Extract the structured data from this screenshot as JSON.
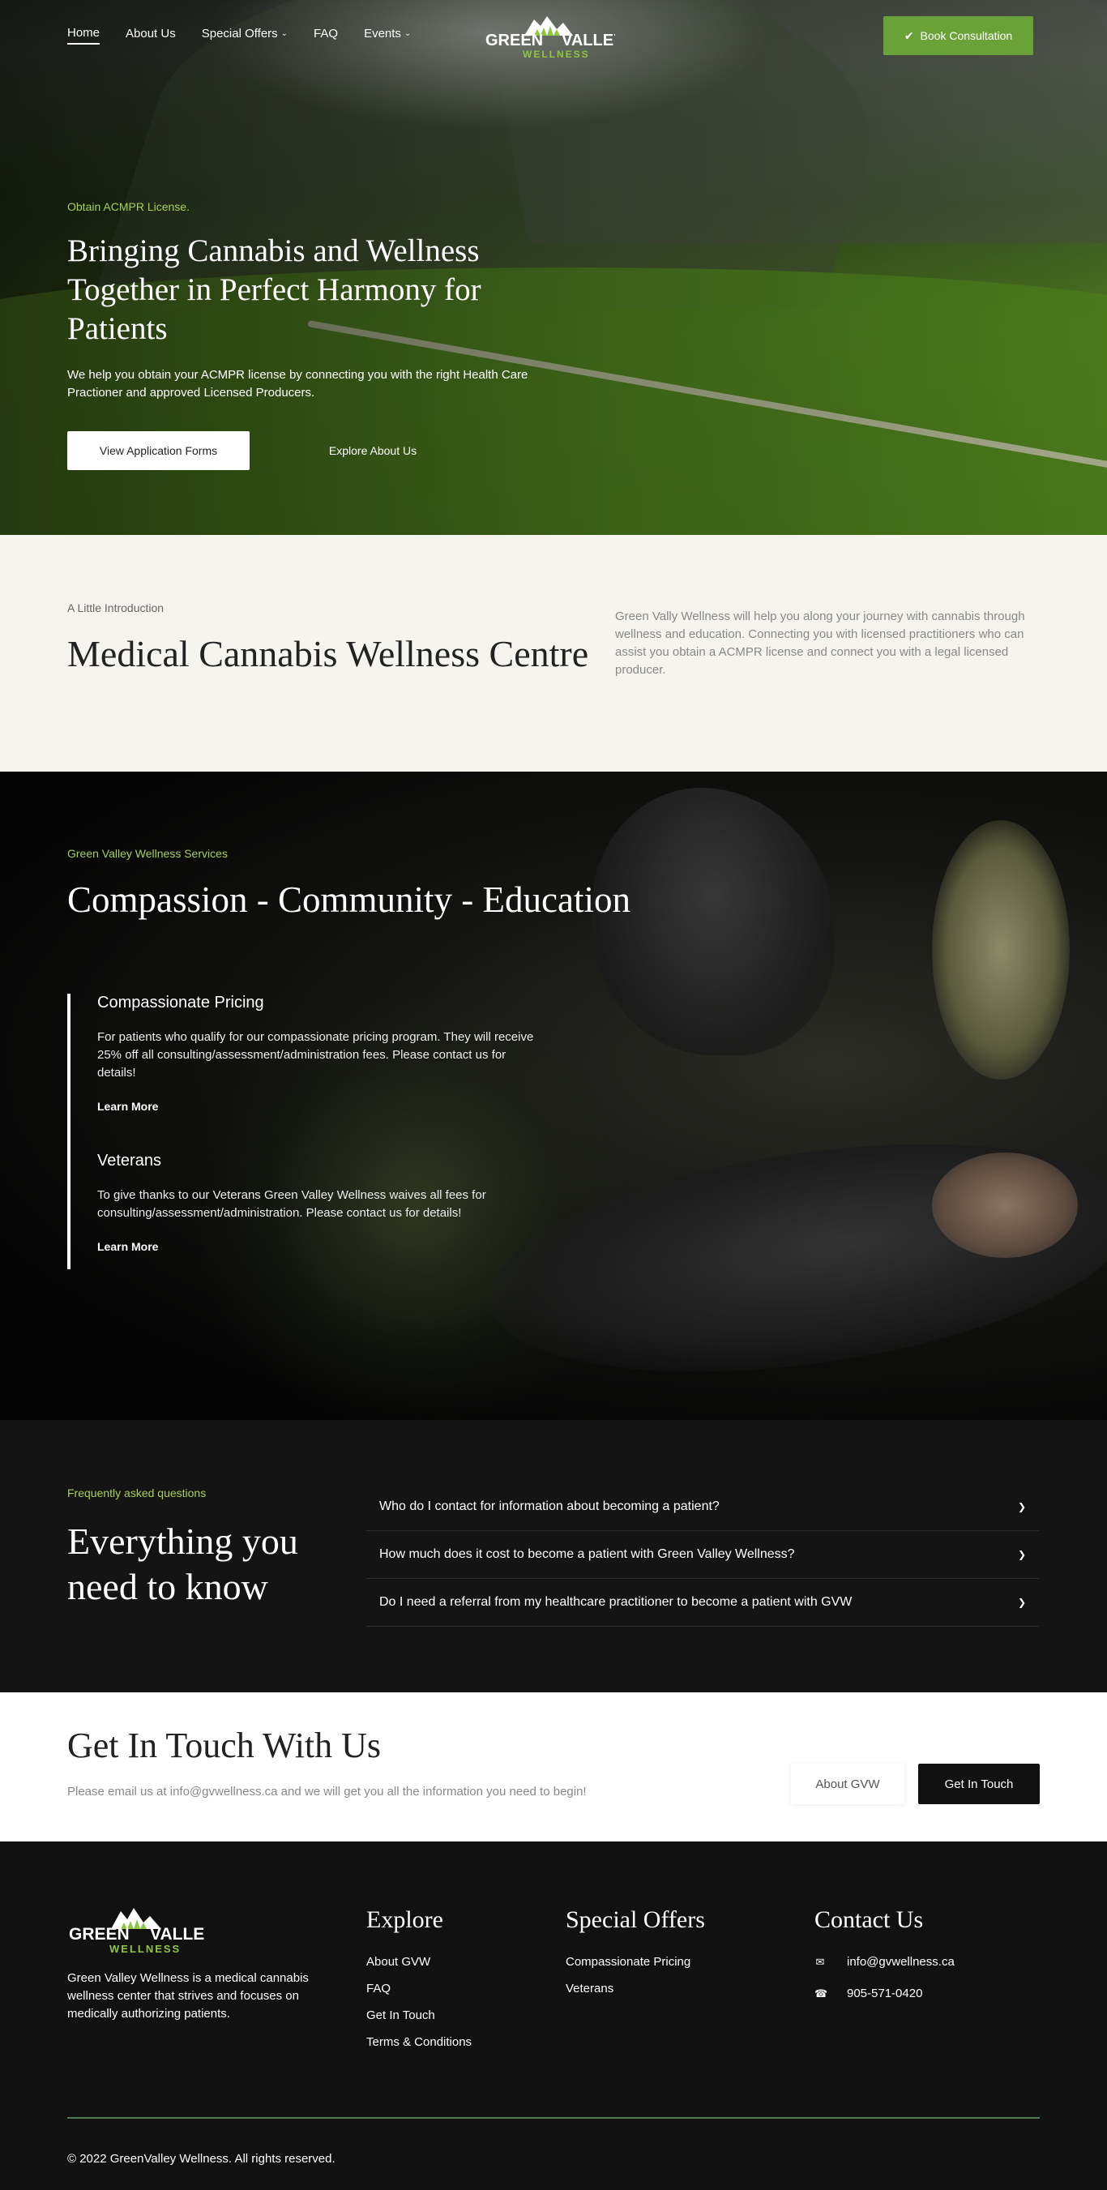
{
  "nav": {
    "items": [
      {
        "label": "Home",
        "active": true,
        "dropdown": false
      },
      {
        "label": "About Us",
        "active": false,
        "dropdown": false
      },
      {
        "label": "Special Offers",
        "active": false,
        "dropdown": true
      },
      {
        "label": "FAQ",
        "active": false,
        "dropdown": false
      },
      {
        "label": "Events",
        "active": false,
        "dropdown": true
      }
    ],
    "logo": {
      "line1_left": "GREEN",
      "line1_right": "VALLEY",
      "line2": "WELLNESS"
    },
    "book_button": "Book Consultation",
    "book_icon": "check-icon"
  },
  "hero": {
    "eyebrow": "Obtain ACMPR License.",
    "title": "Bringing Cannabis and Wellness Together in Perfect Harmony for Patients",
    "subtitle": "We help you obtain your ACMPR license by connecting you with the right Health Care Practioner and approved Licensed Producers.",
    "primary_button": "View Application Forms",
    "secondary_button": "Explore About Us"
  },
  "intro": {
    "eyebrow": "A Little Introduction",
    "title": "Medical Cannabis Wellness Centre",
    "text": "Green Vally Wellness will help you along your journey with cannabis through wellness and education. Connecting you with licensed practitioners who can assist you obtain a ACMPR license and connect you with a legal licensed producer."
  },
  "services": {
    "eyebrow": "Green Valley Wellness Services",
    "title": "Compassion - Community - Education",
    "items": [
      {
        "title": "Compassionate Pricing",
        "text": "For patients who qualify for our compassionate pricing program. They will receive 25% off all consulting/assessment/administration fees. Please contact us for details!",
        "link": "Learn More"
      },
      {
        "title": "Veterans",
        "text": "To give thanks to our Veterans Green Valley Wellness waives all fees for consulting/assessment/administration. Please contact us for details!",
        "link": "Learn More"
      }
    ]
  },
  "faq": {
    "eyebrow": "Frequently asked questions",
    "title": "Everything you need to know",
    "questions": [
      "Who do I contact for information about becoming a patient?",
      "How much does it cost to become a patient with Green Valley Wellness?",
      "Do I need a referral from my healthcare practitioner to become a patient with GVW"
    ]
  },
  "contact": {
    "title": "Get In Touch With Us",
    "text": "Please email us at info@gvwellness.ca and we will get you all the information you need to begin!",
    "about_button": "About GVW",
    "touch_button": "Get In Touch"
  },
  "footer": {
    "description": "Green Valley Wellness is a medical cannabis wellness center that strives and focuses on medically authorizing patients.",
    "explore": {
      "heading": "Explore",
      "links": [
        "About GVW",
        "FAQ",
        "Get In Touch",
        "Terms & Conditions"
      ]
    },
    "offers": {
      "heading": "Special Offers",
      "links": [
        "Compassionate Pricing",
        "Veterans"
      ]
    },
    "contact": {
      "heading": "Contact Us",
      "email": "info@gvwellness.ca",
      "phone": "905-571-0420",
      "email_icon": "envelope-icon",
      "phone_icon": "phone-icon"
    },
    "copyright": "© 2022 GreenValley Wellness. All rights reserved."
  },
  "colors": {
    "accent_green": "#6aa238",
    "eyebrow_green": "#a8d057",
    "cream": "#f5f4ef",
    "dark": "#111111",
    "rule_green": "#4f7c58"
  }
}
